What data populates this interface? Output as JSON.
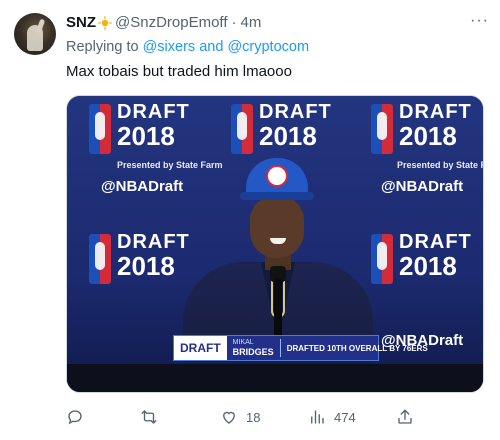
{
  "author": {
    "name": "SNZ",
    "handle": "@SnzDropEmoff",
    "separator": "·",
    "time": "4m"
  },
  "reply": {
    "prefix": "Replying to",
    "mention_1": "@sixers",
    "conjunction": "and",
    "mention_2": "@cryptocom"
  },
  "tweet_text": "Max tobais but traded him lmaooo",
  "image": {
    "backdrop_words": {
      "draft": "DRAFT",
      "year": "2018",
      "sponsor": "Presented by State Farm",
      "hashtag": "@NBADraft"
    },
    "lower_third": {
      "logo": "DRAFT",
      "first_name": "MIKAL",
      "last_name": "BRIDGES",
      "info": "DRAFTED 10TH OVERALL BY 76ERS"
    }
  },
  "actions": {
    "reply_count": "",
    "retweet_count": "",
    "like_count": "18",
    "views_count": "474"
  },
  "colors": {
    "accent": "#1d9bf0",
    "secondary_text": "#536471",
    "primary_text": "#0f1419"
  },
  "icons": [
    "more-icon",
    "sun-emoji-icon",
    "reply-icon",
    "retweet-icon",
    "like-icon",
    "views-icon",
    "share-icon"
  ]
}
